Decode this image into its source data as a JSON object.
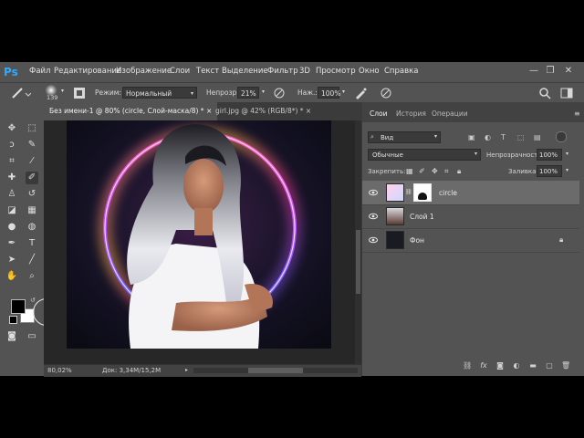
{
  "app": {
    "logo": "Ps"
  },
  "menu": [
    "Файл",
    "Редактирование",
    "Изображение",
    "Слои",
    "Текст",
    "Выделение",
    "Фильтр",
    "3D",
    "Просмотр",
    "Окно",
    "Справка"
  ],
  "window_controls": {
    "minimize": "—",
    "restore": "❐",
    "close": "✕"
  },
  "options_bar": {
    "brush_size": "139",
    "mode_label": "Режим:",
    "mode_value": "Нормальный",
    "opacity_label": "Непрозр.:",
    "opacity_value": "21%",
    "flow_label": "Наж.:",
    "flow_value": "100%"
  },
  "document_tabs": [
    {
      "label": "Без имени-1 @ 80% (circle, Слой-маска/8) *",
      "close": "×"
    },
    {
      "label": "girl.jpg @ 42% (RGB/8*) *",
      "close": "×"
    }
  ],
  "status": {
    "zoom": "80,02%",
    "doc": "Док: 3,34M/15,2M"
  },
  "colors": {
    "foreground": "#000000",
    "background": "#ffffff",
    "accent": "#31a8ff",
    "ring_pink": "#ff3aa0",
    "ring_blue": "#2f5bff"
  },
  "panel": {
    "tabs": [
      "Слои",
      "История",
      "Операции"
    ],
    "filter_label": "Вид",
    "blend_mode": "Обычные",
    "opacity_label": "Непрозрачность:",
    "opacity_value": "100%",
    "lock_label": "Закрепить:",
    "fill_label": "Заливка:",
    "fill_value": "100%",
    "layers": [
      {
        "name": "circle",
        "selected": true
      },
      {
        "name": "Слой 1",
        "selected": false
      },
      {
        "name": "Фон",
        "selected": false,
        "locked": true
      }
    ]
  }
}
